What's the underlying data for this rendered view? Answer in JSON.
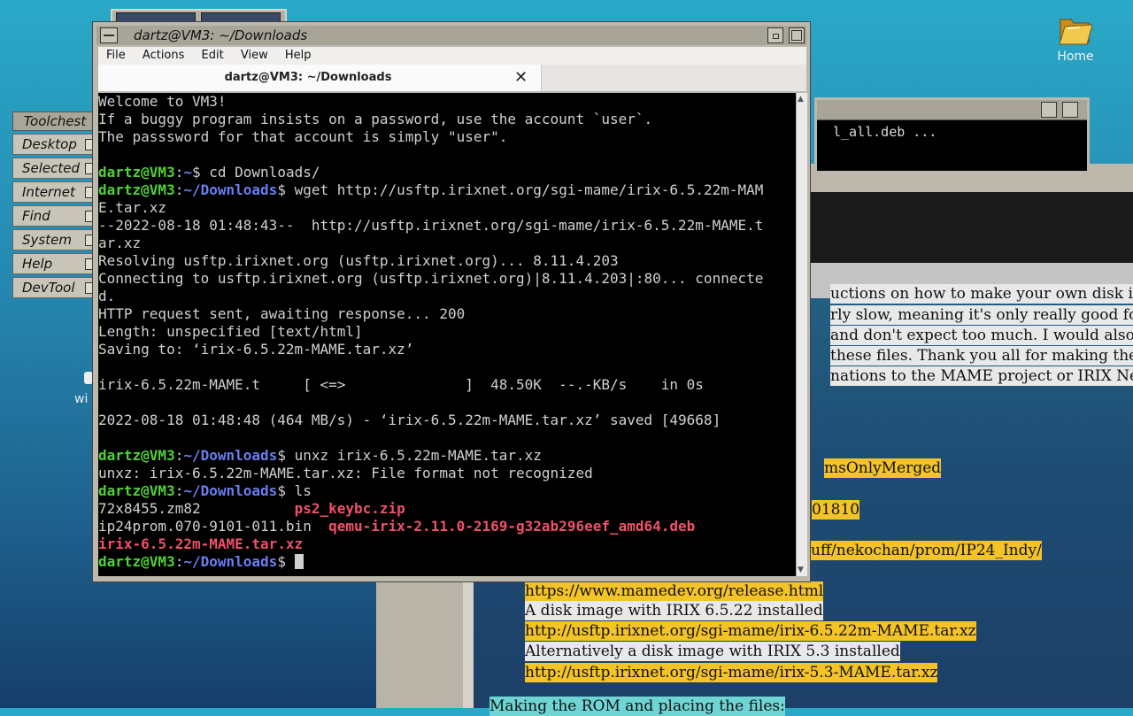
{
  "desktop": {
    "home_label": "Home",
    "partial_label": "wi"
  },
  "toolchest": {
    "title": "Toolchest",
    "items": [
      "Desktop",
      "Selected",
      "Internet",
      "Find",
      "System",
      "Help",
      "DevTool"
    ]
  },
  "terminal": {
    "window_title": "dartz@VM3: ~/Downloads",
    "tab_title": "dartz@VM3: ~/Downloads",
    "menu": [
      "File",
      "Actions",
      "Edit",
      "View",
      "Help"
    ],
    "lines": [
      "Welcome to VM3!",
      "If a buggy program insists on a password, use the account `user`.",
      "The passsword for that account is simply \"user\".",
      "",
      {
        "user": "dartz@VM3",
        "path": "~",
        "cmd": "$ cd Downloads/"
      },
      {
        "user": "dartz@VM3",
        "path": "~/Downloads",
        "cmd": "$ wget http://usftp.irixnet.org/sgi-mame/irix-6.5.22m-MAM"
      },
      "E.tar.xz",
      "--2022-08-18 01:48:43--  http://usftp.irixnet.org/sgi-mame/irix-6.5.22m-MAME.t",
      "ar.xz",
      "Resolving usftp.irixnet.org (usftp.irixnet.org)... 8.11.4.203",
      "Connecting to usftp.irixnet.org (usftp.irixnet.org)|8.11.4.203|:80... connecte",
      "d.",
      "HTTP request sent, awaiting response... 200",
      "Length: unspecified [text/html]",
      "Saving to: ‘irix-6.5.22m-MAME.tar.xz’",
      "",
      "irix-6.5.22m-MAME.t     [ <=>              ]  48.50K  --.-KB/s    in 0s",
      "",
      "2022-08-18 01:48:48 (464 MB/s) - ‘irix-6.5.22m-MAME.tar.xz’ saved [49668]",
      "",
      {
        "user": "dartz@VM3",
        "path": "~/Downloads",
        "cmd": "$ unxz irix-6.5.22m-MAME.tar.xz"
      },
      "unxz: irix-6.5.22m-MAME.tar.xz: File format not recognized",
      {
        "user": "dartz@VM3",
        "path": "~/Downloads",
        "cmd": "$ ls"
      },
      {
        "ls": [
          {
            "t": "72x8455.zm82           ",
            "c": ""
          },
          {
            "t": "ps2_keybc.zip",
            "c": "r"
          }
        ]
      },
      {
        "ls": [
          {
            "t": "ip24prom.070-9101-011.bin  ",
            "c": ""
          },
          {
            "t": "qemu-irix-2.11.0-2169-g32ab296eef_amd64.deb",
            "c": "r"
          }
        ]
      },
      {
        "ls": [
          {
            "t": "irix-6.5.22m-MAME.tar.xz",
            "c": "r"
          }
        ]
      },
      {
        "user": "dartz@VM3",
        "path": "~/Downloads",
        "cmd": "$ ",
        "cursor": true
      }
    ]
  },
  "back_terminal": {
    "text": "l_all.deb ..."
  },
  "browser_doc": {
    "lines": [
      {
        "text": "uctions on how to make your own disk imag",
        "hl": "w"
      },
      {
        "text": "rly slow, meaning it's only really good for ex",
        "hl": "w"
      },
      {
        "text": "and don't expect too much. I would also lik",
        "hl": "w"
      },
      {
        "text": "these files. Thank you all for making the pr",
        "hl": "w"
      },
      {
        "text": "nations to the MAME project or IRIX Netwo",
        "hl": "w"
      },
      {
        "text": "msOnlyMerged",
        "hl": "y"
      },
      {
        "text": "01810",
        "hl": "y"
      },
      {
        "text": "uff/nekochan/prom/IP24_Indy/",
        "hl": "y"
      },
      {
        "text": "https://www.mamedev.org/release.html",
        "hl": "y"
      },
      {
        "text": "A disk image with IRIX 6.5.22 installed",
        "hl": "w"
      },
      {
        "text": "http://usftp.irixnet.org/sgi-mame/irix-6.5.22m-MAME.tar.xz",
        "hl": "y"
      },
      {
        "text": "Alternatively a disk image with IRIX 5.3 installed",
        "hl": "w"
      },
      {
        "text": "http://usftp.irixnet.org/sgi-mame/irix-5.3-MAME.tar.xz",
        "hl": "y"
      },
      {
        "text": "Making the ROM and placing the files:",
        "hl": "c"
      }
    ]
  }
}
